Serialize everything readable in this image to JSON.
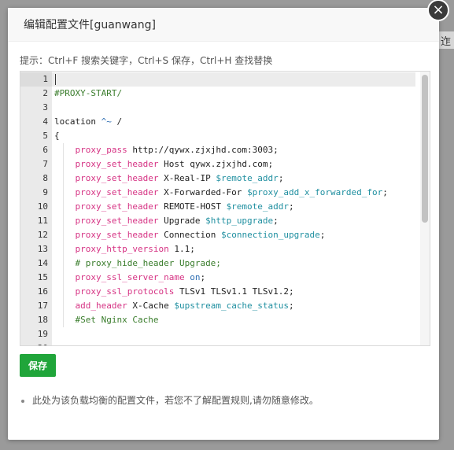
{
  "dialog": {
    "title": "编辑配置文件[guanwang]",
    "close_symbol": "×"
  },
  "background": {
    "partial_text": "迮"
  },
  "hint": "提示：Ctrl+F 搜索关键字，Ctrl+S 保存，Ctrl+H 查找替换",
  "editor": {
    "lines": [
      {
        "n": "1",
        "segments": []
      },
      {
        "n": "2",
        "segments": [
          {
            "t": "#PROXY-START/",
            "c": "cmt"
          }
        ]
      },
      {
        "n": "3",
        "segments": []
      },
      {
        "n": "4",
        "segments": [
          {
            "t": "location ",
            "c": "plain"
          },
          {
            "t": "^~",
            "c": "kw"
          },
          {
            "t": " /",
            "c": "plain"
          }
        ]
      },
      {
        "n": "5",
        "segments": [
          {
            "t": "{",
            "c": "plain"
          }
        ]
      },
      {
        "n": "6",
        "segments": [
          {
            "t": "    ",
            "c": "plain"
          },
          {
            "t": "proxy_pass",
            "c": "dir"
          },
          {
            "t": " http://qywx.zjxjhd.com:3003;",
            "c": "plain"
          }
        ]
      },
      {
        "n": "7",
        "segments": [
          {
            "t": "    ",
            "c": "plain"
          },
          {
            "t": "proxy_set_header",
            "c": "dir"
          },
          {
            "t": " Host qywx.zjxjhd.com;",
            "c": "plain"
          }
        ]
      },
      {
        "n": "8",
        "segments": [
          {
            "t": "    ",
            "c": "plain"
          },
          {
            "t": "proxy_set_header",
            "c": "dir"
          },
          {
            "t": " X-Real-IP ",
            "c": "plain"
          },
          {
            "t": "$remote_addr",
            "c": "var"
          },
          {
            "t": ";",
            "c": "plain"
          }
        ]
      },
      {
        "n": "9",
        "segments": [
          {
            "t": "    ",
            "c": "plain"
          },
          {
            "t": "proxy_set_header",
            "c": "dir"
          },
          {
            "t": " X-Forwarded-For ",
            "c": "plain"
          },
          {
            "t": "$proxy_add_x_forwarded_for",
            "c": "var"
          },
          {
            "t": ";",
            "c": "plain"
          }
        ]
      },
      {
        "n": "10",
        "segments": [
          {
            "t": "    ",
            "c": "plain"
          },
          {
            "t": "proxy_set_header",
            "c": "dir"
          },
          {
            "t": " REMOTE-HOST ",
            "c": "plain"
          },
          {
            "t": "$remote_addr",
            "c": "var"
          },
          {
            "t": ";",
            "c": "plain"
          }
        ]
      },
      {
        "n": "11",
        "segments": [
          {
            "t": "    ",
            "c": "plain"
          },
          {
            "t": "proxy_set_header",
            "c": "dir"
          },
          {
            "t": " Upgrade ",
            "c": "plain"
          },
          {
            "t": "$http_upgrade",
            "c": "var"
          },
          {
            "t": ";",
            "c": "plain"
          }
        ]
      },
      {
        "n": "12",
        "segments": [
          {
            "t": "    ",
            "c": "plain"
          },
          {
            "t": "proxy_set_header",
            "c": "dir"
          },
          {
            "t": " Connection ",
            "c": "plain"
          },
          {
            "t": "$connection_upgrade",
            "c": "var"
          },
          {
            "t": ";",
            "c": "plain"
          }
        ]
      },
      {
        "n": "13",
        "segments": [
          {
            "t": "    ",
            "c": "plain"
          },
          {
            "t": "proxy_http_version",
            "c": "dir"
          },
          {
            "t": " 1.1;",
            "c": "plain"
          }
        ]
      },
      {
        "n": "14",
        "segments": [
          {
            "t": "    ",
            "c": "plain"
          },
          {
            "t": "# proxy_hide_header Upgrade;",
            "c": "cmt"
          }
        ]
      },
      {
        "n": "15",
        "segments": [
          {
            "t": "    ",
            "c": "plain"
          },
          {
            "t": "proxy_ssl_server_name",
            "c": "dir"
          },
          {
            "t": " ",
            "c": "plain"
          },
          {
            "t": "on",
            "c": "kw"
          },
          {
            "t": ";",
            "c": "plain"
          }
        ]
      },
      {
        "n": "16",
        "segments": [
          {
            "t": "    ",
            "c": "plain"
          },
          {
            "t": "proxy_ssl_protocols",
            "c": "dir"
          },
          {
            "t": " TLSv1 TLSv1.1 TLSv1.2;",
            "c": "plain"
          }
        ]
      },
      {
        "n": "17",
        "segments": [
          {
            "t": "    ",
            "c": "plain"
          },
          {
            "t": "add_header",
            "c": "dir"
          },
          {
            "t": " X-Cache ",
            "c": "plain"
          },
          {
            "t": "$upstream_cache_status",
            "c": "var"
          },
          {
            "t": ";",
            "c": "plain"
          }
        ]
      },
      {
        "n": "18",
        "segments": [
          {
            "t": "    ",
            "c": "plain"
          },
          {
            "t": "#Set Nginx Cache",
            "c": "cmt"
          }
        ]
      },
      {
        "n": "19",
        "segments": []
      },
      {
        "n": "20",
        "segments": []
      }
    ]
  },
  "save_label": "保存",
  "note": "此处为该负载均衡的配置文件，若您不了解配置规则,请勿随意修改。",
  "colors": {
    "directive": "#d63384",
    "variable": "#1f8fa0",
    "comment": "#3a7d2c",
    "keyword": "#2f6fb3",
    "save_button": "#20a53a"
  }
}
